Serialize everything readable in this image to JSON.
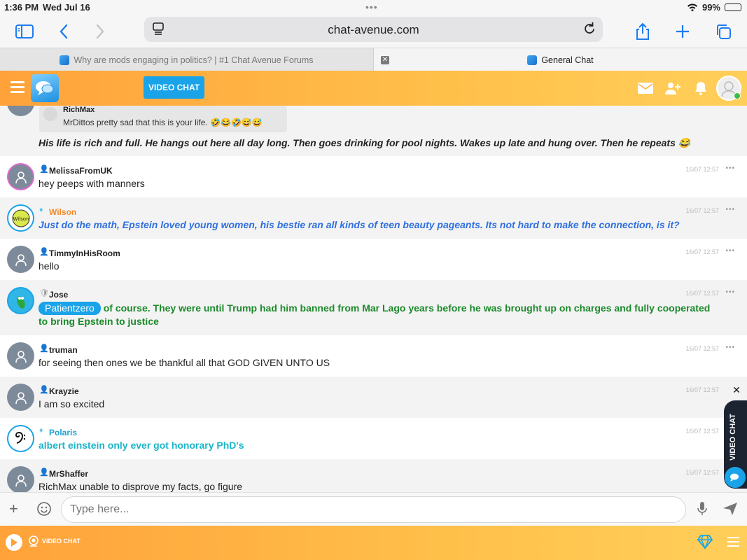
{
  "status_bar": {
    "time": "1:36 PM",
    "date": "Wed Jul 16",
    "battery": "99%",
    "battery_level": 0.99
  },
  "browser": {
    "url": "chat-avenue.com",
    "tabs": [
      {
        "title": "Why are mods engaging in politics? | #1 Chat Avenue Forums",
        "active": false
      },
      {
        "title": "General Chat",
        "active": true
      }
    ]
  },
  "header": {
    "video_chat_label": "VIDEO CHAT"
  },
  "messages": [
    {
      "quote": {
        "user": "RichMax",
        "text": "MrDittos pretty sad that this is your life. 🤣😂🤣😅😅"
      },
      "text": "His life is rich and full. He hangs out here all day long. Then goes drinking for pool nights. Wakes up late and hung over. Then he repeats 😂",
      "color": "#222222"
    },
    {
      "user": "MelissaFromUK",
      "time": "16/07 12:57",
      "text": "hey peeps with manners",
      "color": "#222222"
    },
    {
      "user": "Wilson",
      "time": "16/07 12:57",
      "text": "Just do the math, Epstein loved young women, his bestie ran all kinds of teen beauty pageants. Its not hard to make the connection, is it?",
      "color": "#2f6fe0",
      "name_color": "#f08a2a"
    },
    {
      "user": "TimmyInHisRoom",
      "time": "16/07 12:57",
      "text": "hello",
      "color": "#222222"
    },
    {
      "user": "Jose",
      "time": "16/07 12:57",
      "mention": "Patientzero",
      "text": "of course. They were until Trump had him banned from Mar Lago years before he was brought up on charges and fully cooperated to bring Epstein to justice",
      "color": "#1b8a2a"
    },
    {
      "user": "truman",
      "time": "16/07 12:57",
      "text": "for seeing then ones we be thankful all that GOD GIVEN UNTO US",
      "color": "#222222"
    },
    {
      "user": "Krayzie",
      "time": "16/07 12:57",
      "text": "I am so excited",
      "color": "#222222"
    },
    {
      "user": "Polaris",
      "time": "16/07 12:57",
      "text": "albert einstein only ever got honorary PhD's",
      "color": "#1bb5c9",
      "name_color": "#1b9fd0"
    },
    {
      "user": "MrShaffer",
      "time": "16/07 12:57",
      "text": "RichMax unable to disprove my facts, go figure",
      "color": "#222222"
    }
  ],
  "side_tab": {
    "label": "VIDEO CHAT"
  },
  "input": {
    "placeholder": "Type here..."
  },
  "bottom_bar": {
    "video_chat_label": "VIDEO CHAT"
  }
}
